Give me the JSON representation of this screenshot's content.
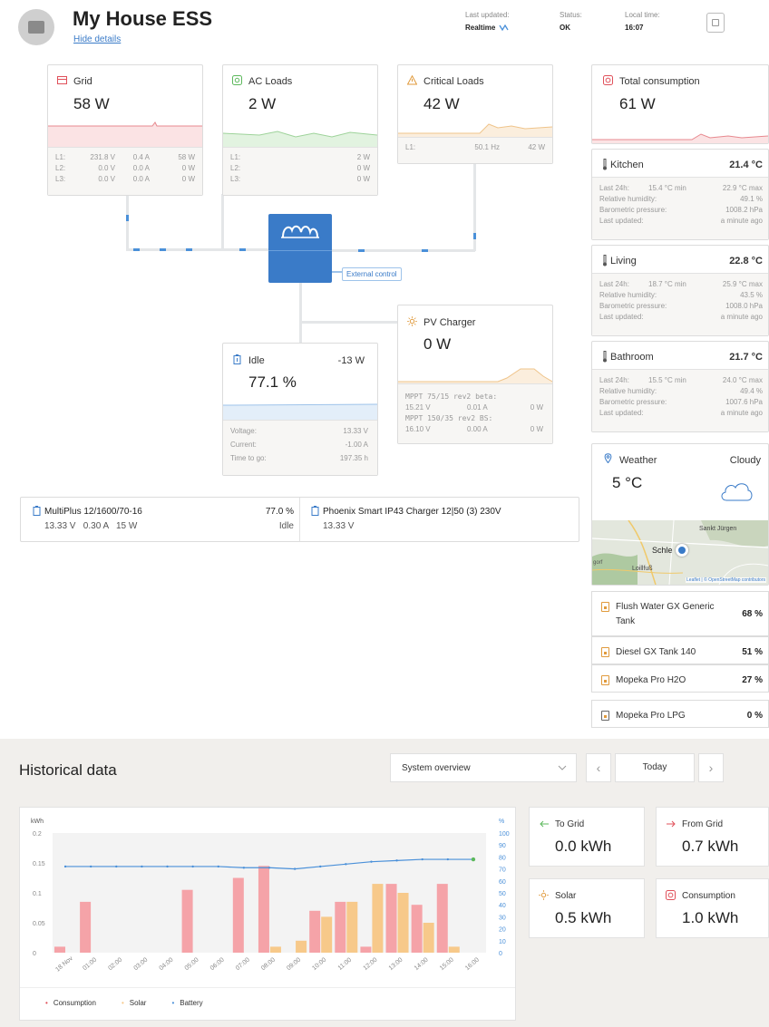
{
  "header": {
    "title": "My House ESS",
    "hide_details": "Hide details",
    "last_updated_label": "Last updated:",
    "last_updated_value": "Realtime",
    "status_label": "Status:",
    "status_value": "OK",
    "local_time_label": "Local time:",
    "local_time_value": "16:07"
  },
  "grid": {
    "title": "Grid",
    "value": "58 W",
    "rows": [
      [
        "L1:",
        "231.8 V",
        "0.4 A",
        "58 W"
      ],
      [
        "L2:",
        "0.0 V",
        "0.0 A",
        "0 W"
      ],
      [
        "L3:",
        "0.0 V",
        "0.0 A",
        "0 W"
      ]
    ]
  },
  "ac_loads": {
    "title": "AC Loads",
    "value": "2 W",
    "rows": [
      [
        "L1:",
        "2 W"
      ],
      [
        "L2:",
        "0 W"
      ],
      [
        "L3:",
        "0 W"
      ]
    ]
  },
  "critical": {
    "title": "Critical Loads",
    "value": "42 W",
    "rows": [
      [
        "L1:",
        "50.1 Hz",
        "42 W"
      ]
    ]
  },
  "external_control": "External control",
  "battery": {
    "state": "Idle",
    "power": "-13 W",
    "soc": "77.1 %",
    "soc_fraction": 0.771,
    "rows": [
      [
        "Voltage:",
        "13.33 V"
      ],
      [
        "Current:",
        "-1.00 A"
      ],
      [
        "Time to go:",
        "197.35 h"
      ]
    ]
  },
  "pv": {
    "title": "PV Charger",
    "value": "0 W",
    "chargers": [
      {
        "name": "MPPT 75/15 rev2 beta:",
        "v": "15.21 V",
        "a": "0.01 A",
        "w": "0 W"
      },
      {
        "name": "MPPT 150/35 rev2 BS:",
        "v": "16.10 V",
        "a": "0.00 A",
        "w": "0 W"
      }
    ]
  },
  "devices": [
    {
      "name": "MultiPlus 12/1600/70-16",
      "pct": "77.0 %",
      "line": "13.33 V   0.30 A   15 W",
      "state": "Idle"
    },
    {
      "name": "Phoenix Smart IP43 Charger 12|50 (3) 230V",
      "line": "13.33 V"
    }
  ],
  "total": {
    "title": "Total consumption",
    "value": "61 W"
  },
  "sensors": [
    {
      "name": "Kitchen",
      "temp": "21.4 °C",
      "last24_label": "Last 24h:",
      "min": "15.4 °C min",
      "max": "22.9 °C max",
      "hum_label": "Relative humidity:",
      "hum": "49.1 %",
      "baro_label": "Barometric pressure:",
      "baro": "1008.2 hPa",
      "upd_label": "Last updated:",
      "upd": "a minute ago"
    },
    {
      "name": "Living",
      "temp": "22.8 °C",
      "last24_label": "Last 24h:",
      "min": "18.7 °C min",
      "max": "25.9 °C max",
      "hum_label": "Relative humidity:",
      "hum": "43.5 %",
      "baro_label": "Barometric pressure:",
      "baro": "1008.0 hPa",
      "upd_label": "Last updated:",
      "upd": "a minute ago"
    },
    {
      "name": "Bathroom",
      "temp": "21.7 °C",
      "last24_label": "Last 24h:",
      "min": "15.5 °C min",
      "max": "24.0 °C max",
      "hum_label": "Relative humidity:",
      "hum": "49.4 %",
      "baro_label": "Barometric pressure:",
      "baro": "1007.6 hPa",
      "upd_label": "Last updated:",
      "upd": "a minute ago"
    }
  ],
  "weather": {
    "title": "Weather",
    "condition": "Cloudy",
    "temp": "5 °C",
    "map_town1": "Sankt Jürgen",
    "map_town2": "Schle",
    "map_town3": "Loillfuß",
    "map_edge": "gorf",
    "map_credit": "Leaflet | © OpenStreetMap contributors"
  },
  "tanks": [
    {
      "name": "Flush Water GX Generic",
      "name2": "Tank",
      "pct": "68 %"
    },
    {
      "name": "Diesel GX Tank 140",
      "pct": "51 %"
    },
    {
      "name": "Mopeka Pro H2O",
      "pct": "27 %"
    },
    {
      "name": "Mopeka Pro LPG",
      "pct": "0 %"
    }
  ],
  "historical": {
    "title": "Historical data",
    "select": "System overview",
    "prev": "‹",
    "next": "›",
    "day": "Today"
  },
  "summary": [
    {
      "title": "To Grid",
      "value": "0.0 kWh"
    },
    {
      "title": "From Grid",
      "value": "0.7 kWh"
    },
    {
      "title": "Solar",
      "value": "0.5 kWh"
    },
    {
      "title": "Consumption",
      "value": "1.0 kWh"
    }
  ],
  "colors": {
    "consumption": "#f5a3a8",
    "solar": "#f7c98a",
    "battery": "#4a90d9",
    "grid": "#e0505a",
    "ac": "#5cb85c",
    "warn": "#e09a3c",
    "brand": "#3a7bc8"
  },
  "chart_data": {
    "type": "bar",
    "ylabel": "kWh",
    "y2label": "%",
    "ylim": [
      0,
      0.2
    ],
    "y2lim": [
      0,
      100
    ],
    "yticks": [
      "0.2",
      "0.15",
      "0.1",
      "0.05",
      "0"
    ],
    "y2ticks": [
      "100",
      "90",
      "80",
      "70",
      "60",
      "50",
      "40",
      "30",
      "20",
      "10",
      "0"
    ],
    "categories": [
      "18 Nov",
      "01:00",
      "02:00",
      "03:00",
      "04:00",
      "05:00",
      "06:00",
      "07:00",
      "08:00",
      "09:00",
      "10:00",
      "11:00",
      "12:00",
      "13:00",
      "14:00",
      "15:00",
      "16:00"
    ],
    "series": [
      {
        "name": "Consumption",
        "values": [
          0.01,
          0.085,
          0,
          0,
          0,
          0.105,
          0,
          0.125,
          0.145,
          0,
          0.07,
          0.085,
          0.01,
          0.115,
          0.08,
          0.115,
          0
        ]
      },
      {
        "name": "Solar",
        "values": [
          0,
          0,
          0,
          0,
          0,
          0,
          0,
          0,
          0.01,
          0.02,
          0.06,
          0.085,
          0.115,
          0.1,
          0.05,
          0.01,
          0
        ]
      },
      {
        "name": "Battery",
        "values": [
          72,
          72,
          72,
          72,
          72,
          72,
          72,
          71,
          71,
          70,
          72,
          74,
          76,
          77,
          78,
          78,
          78
        ]
      }
    ],
    "legend": [
      "Consumption",
      "Solar",
      "Battery"
    ]
  }
}
